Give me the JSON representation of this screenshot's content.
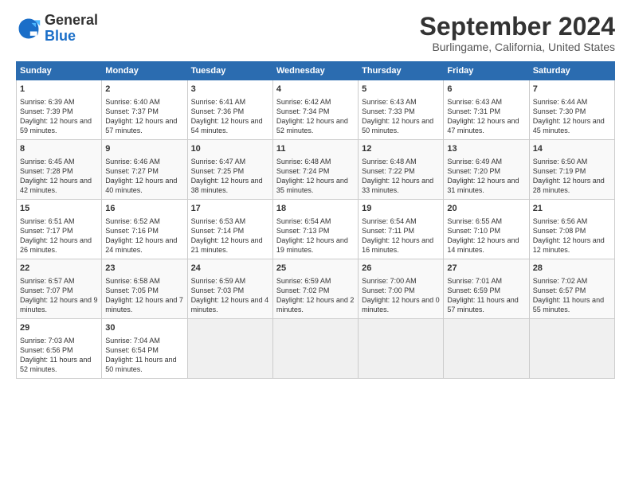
{
  "logo": {
    "line1": "General",
    "line2": "Blue"
  },
  "title": "September 2024",
  "subtitle": "Burlingame, California, United States",
  "days_header": [
    "Sunday",
    "Monday",
    "Tuesday",
    "Wednesday",
    "Thursday",
    "Friday",
    "Saturday"
  ],
  "weeks": [
    [
      {
        "day": "1",
        "sunrise": "6:39 AM",
        "sunset": "7:39 PM",
        "daylight": "12 hours and 59 minutes."
      },
      {
        "day": "2",
        "sunrise": "6:40 AM",
        "sunset": "7:37 PM",
        "daylight": "12 hours and 57 minutes."
      },
      {
        "day": "3",
        "sunrise": "6:41 AM",
        "sunset": "7:36 PM",
        "daylight": "12 hours and 54 minutes."
      },
      {
        "day": "4",
        "sunrise": "6:42 AM",
        "sunset": "7:34 PM",
        "daylight": "12 hours and 52 minutes."
      },
      {
        "day": "5",
        "sunrise": "6:43 AM",
        "sunset": "7:33 PM",
        "daylight": "12 hours and 50 minutes."
      },
      {
        "day": "6",
        "sunrise": "6:43 AM",
        "sunset": "7:31 PM",
        "daylight": "12 hours and 47 minutes."
      },
      {
        "day": "7",
        "sunrise": "6:44 AM",
        "sunset": "7:30 PM",
        "daylight": "12 hours and 45 minutes."
      }
    ],
    [
      {
        "day": "8",
        "sunrise": "6:45 AM",
        "sunset": "7:28 PM",
        "daylight": "12 hours and 42 minutes."
      },
      {
        "day": "9",
        "sunrise": "6:46 AM",
        "sunset": "7:27 PM",
        "daylight": "12 hours and 40 minutes."
      },
      {
        "day": "10",
        "sunrise": "6:47 AM",
        "sunset": "7:25 PM",
        "daylight": "12 hours and 38 minutes."
      },
      {
        "day": "11",
        "sunrise": "6:48 AM",
        "sunset": "7:24 PM",
        "daylight": "12 hours and 35 minutes."
      },
      {
        "day": "12",
        "sunrise": "6:48 AM",
        "sunset": "7:22 PM",
        "daylight": "12 hours and 33 minutes."
      },
      {
        "day": "13",
        "sunrise": "6:49 AM",
        "sunset": "7:20 PM",
        "daylight": "12 hours and 31 minutes."
      },
      {
        "day": "14",
        "sunrise": "6:50 AM",
        "sunset": "7:19 PM",
        "daylight": "12 hours and 28 minutes."
      }
    ],
    [
      {
        "day": "15",
        "sunrise": "6:51 AM",
        "sunset": "7:17 PM",
        "daylight": "12 hours and 26 minutes."
      },
      {
        "day": "16",
        "sunrise": "6:52 AM",
        "sunset": "7:16 PM",
        "daylight": "12 hours and 24 minutes."
      },
      {
        "day": "17",
        "sunrise": "6:53 AM",
        "sunset": "7:14 PM",
        "daylight": "12 hours and 21 minutes."
      },
      {
        "day": "18",
        "sunrise": "6:54 AM",
        "sunset": "7:13 PM",
        "daylight": "12 hours and 19 minutes."
      },
      {
        "day": "19",
        "sunrise": "6:54 AM",
        "sunset": "7:11 PM",
        "daylight": "12 hours and 16 minutes."
      },
      {
        "day": "20",
        "sunrise": "6:55 AM",
        "sunset": "7:10 PM",
        "daylight": "12 hours and 14 minutes."
      },
      {
        "day": "21",
        "sunrise": "6:56 AM",
        "sunset": "7:08 PM",
        "daylight": "12 hours and 12 minutes."
      }
    ],
    [
      {
        "day": "22",
        "sunrise": "6:57 AM",
        "sunset": "7:07 PM",
        "daylight": "12 hours and 9 minutes."
      },
      {
        "day": "23",
        "sunrise": "6:58 AM",
        "sunset": "7:05 PM",
        "daylight": "12 hours and 7 minutes."
      },
      {
        "day": "24",
        "sunrise": "6:59 AM",
        "sunset": "7:03 PM",
        "daylight": "12 hours and 4 minutes."
      },
      {
        "day": "25",
        "sunrise": "6:59 AM",
        "sunset": "7:02 PM",
        "daylight": "12 hours and 2 minutes."
      },
      {
        "day": "26",
        "sunrise": "7:00 AM",
        "sunset": "7:00 PM",
        "daylight": "12 hours and 0 minutes."
      },
      {
        "day": "27",
        "sunrise": "7:01 AM",
        "sunset": "6:59 PM",
        "daylight": "11 hours and 57 minutes."
      },
      {
        "day": "28",
        "sunrise": "7:02 AM",
        "sunset": "6:57 PM",
        "daylight": "11 hours and 55 minutes."
      }
    ],
    [
      {
        "day": "29",
        "sunrise": "7:03 AM",
        "sunset": "6:56 PM",
        "daylight": "11 hours and 52 minutes."
      },
      {
        "day": "30",
        "sunrise": "7:04 AM",
        "sunset": "6:54 PM",
        "daylight": "11 hours and 50 minutes."
      },
      null,
      null,
      null,
      null,
      null
    ]
  ]
}
